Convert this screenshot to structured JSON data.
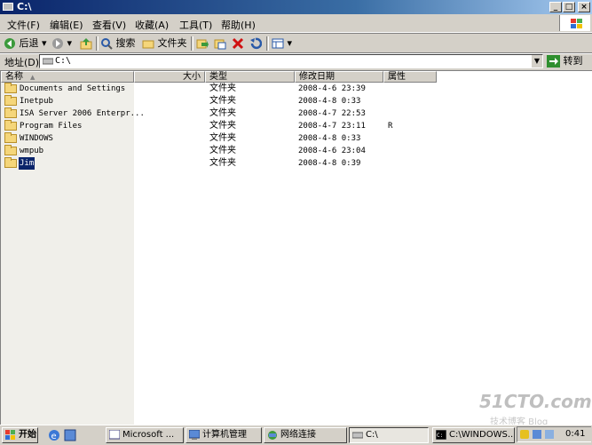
{
  "window": {
    "title": "C:\\"
  },
  "menu": [
    "文件(F)",
    "编辑(E)",
    "查看(V)",
    "收藏(A)",
    "工具(T)",
    "帮助(H)"
  ],
  "toolbar": {
    "back": "后退",
    "search": "搜索",
    "folders": "文件夹"
  },
  "address": {
    "label": "地址(D)",
    "value": "C:\\",
    "go": "转到"
  },
  "columns": {
    "name": "名称",
    "size": "大小",
    "type": "类型",
    "modified": "修改日期",
    "attr": "属性"
  },
  "files": [
    {
      "name": "Documents and Settings",
      "type": "文件夹",
      "modified": "2008-4-6 23:39",
      "attr": ""
    },
    {
      "name": "Inetpub",
      "type": "文件夹",
      "modified": "2008-4-8 0:33",
      "attr": ""
    },
    {
      "name": "ISA Server 2006 Enterpr...",
      "type": "文件夹",
      "modified": "2008-4-7 22:53",
      "attr": ""
    },
    {
      "name": "Program Files",
      "type": "文件夹",
      "modified": "2008-4-7 23:11",
      "attr": "R"
    },
    {
      "name": "WINDOWS",
      "type": "文件夹",
      "modified": "2008-4-8 0:33",
      "attr": ""
    },
    {
      "name": "wmpub",
      "type": "文件夹",
      "modified": "2008-4-6 23:04",
      "attr": ""
    },
    {
      "name": "Jim",
      "type": "文件夹",
      "modified": "2008-4-8 0:39",
      "attr": ""
    }
  ],
  "taskbar": {
    "start": "开始",
    "tasks": [
      "Microsoft ...",
      "计算机管理",
      "网络连接",
      "C:\\",
      "C:\\WINDOWS..."
    ],
    "clock": "0:41"
  },
  "watermark": {
    "main": "51CTO.com",
    "sub": "技术博客 Blog"
  }
}
